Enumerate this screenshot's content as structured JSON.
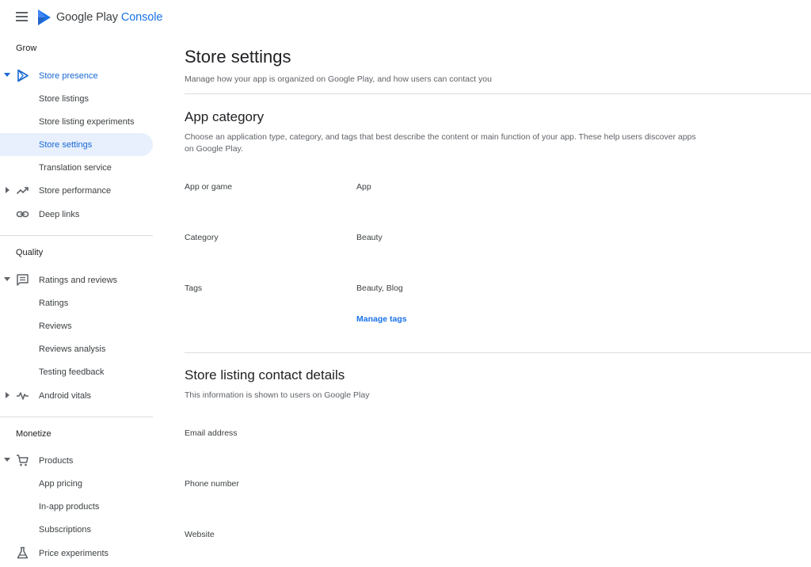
{
  "header": {
    "menu_icon": "hamburger-icon",
    "logo_icon": "play-console-logo-icon",
    "brand_google_play": "Google Play",
    "brand_console": "Console"
  },
  "sidebar": {
    "sections": {
      "grow": "Grow",
      "quality": "Quality",
      "monetize": "Monetize"
    },
    "items": {
      "store_presence": "Store presence",
      "store_listings": "Store listings",
      "store_listing_experiments": "Store listing experiments",
      "store_settings": "Store settings",
      "translation_service": "Translation service",
      "store_performance": "Store performance",
      "deep_links": "Deep links",
      "ratings_and_reviews": "Ratings and reviews",
      "ratings": "Ratings",
      "reviews": "Reviews",
      "reviews_analysis": "Reviews analysis",
      "testing_feedback": "Testing feedback",
      "android_vitals": "Android vitals",
      "products": "Products",
      "app_pricing": "App pricing",
      "in_app_products": "In-app products",
      "subscriptions": "Subscriptions",
      "price_experiments": "Price experiments"
    },
    "active_item": "store_settings",
    "accent_color": "#1967d2",
    "active_bg": "#e8f0fe"
  },
  "main": {
    "title": "Store settings",
    "subtitle": "Manage how your app is organized on Google Play, and how users can contact you",
    "app_category": {
      "heading": "App category",
      "description": "Choose an application type, category, and tags that best describe the content or main function of your app. These help users discover apps on Google Play.",
      "fields": {
        "app_or_game_label": "App or game",
        "app_or_game_value": "App",
        "category_label": "Category",
        "category_value": "Beauty",
        "tags_label": "Tags",
        "tags_value": "Beauty, Blog"
      },
      "manage_tags": "Manage tags"
    },
    "contact_details": {
      "heading": "Store listing contact details",
      "description": "This information is shown to users on Google Play",
      "fields": {
        "email_label": "Email address",
        "phone_label": "Phone number",
        "website_label": "Website"
      }
    }
  }
}
